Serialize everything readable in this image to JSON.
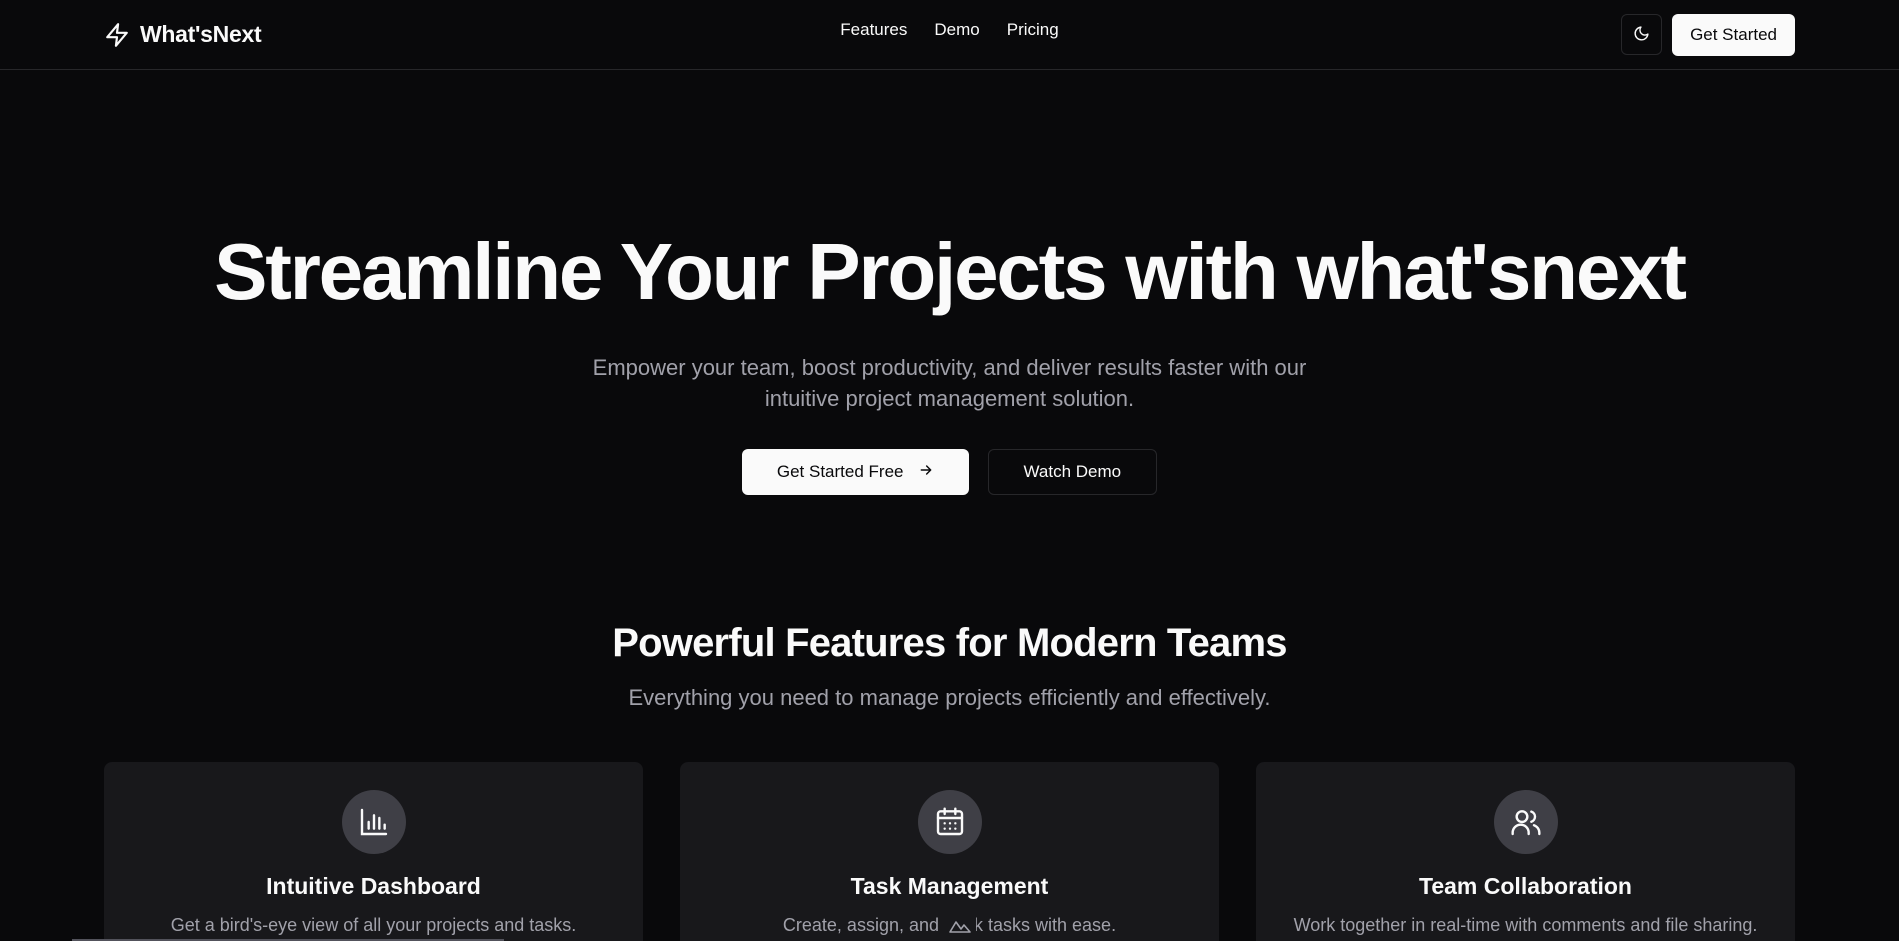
{
  "nav": {
    "brand": "What'sNext",
    "links": [
      "Features",
      "Demo",
      "Pricing"
    ],
    "cta": "Get Started"
  },
  "hero": {
    "title": "Streamline Your Projects with what'snext",
    "subtitle": "Empower your team, boost productivity, and deliver results faster with our intuitive project management solution.",
    "primary_cta": "Get Started Free",
    "secondary_cta": "Watch Demo"
  },
  "features": {
    "title": "Powerful Features for Modern Teams",
    "subtitle": "Everything you need to manage projects efficiently and effectively.",
    "cards": [
      {
        "icon": "bar-chart-icon",
        "title": "Intuitive Dashboard",
        "desc": "Get a bird's-eye view of all your projects and tasks."
      },
      {
        "icon": "calendar-icon",
        "title": "Task Management",
        "desc": "Create, assign, and track tasks with ease."
      },
      {
        "icon": "users-icon",
        "title": "Team Collaboration",
        "desc": "Work together in real-time with comments and file sharing."
      }
    ]
  },
  "colors": {
    "background": "#09090b",
    "card": "#18181b",
    "border": "#27272a",
    "muted_text": "#a1a1aa",
    "foreground": "#fafafa"
  }
}
